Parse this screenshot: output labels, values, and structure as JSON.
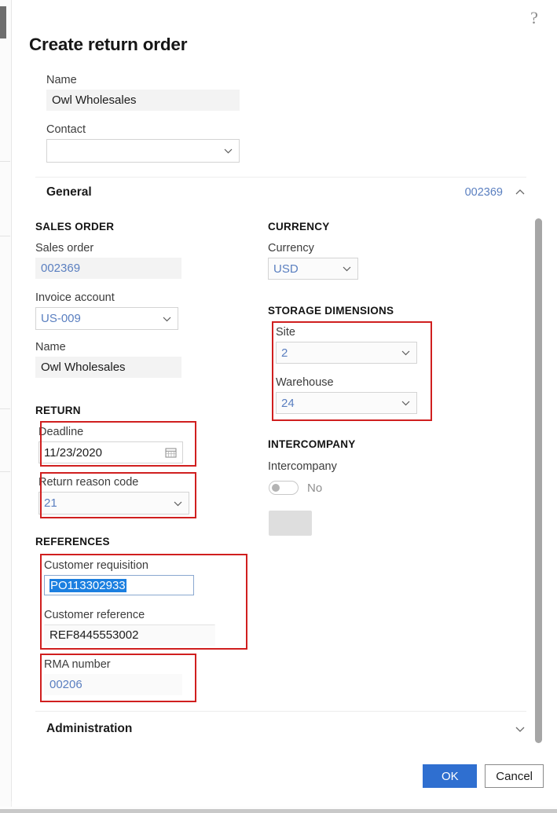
{
  "dialog": {
    "title": "Create return order",
    "help_icon": "question-mark-icon"
  },
  "top_fields": {
    "name": {
      "label": "Name",
      "value": "Owl Wholesales"
    },
    "contact": {
      "label": "Contact",
      "value": ""
    }
  },
  "sections": {
    "general": {
      "title": "General",
      "badge": "002369",
      "caret": "chevron-up-icon"
    },
    "administration": {
      "title": "Administration",
      "caret": "chevron-down-icon"
    }
  },
  "groups": {
    "sales_order": "SALES ORDER",
    "return": "RETURN",
    "references": "REFERENCES",
    "currency": "CURRENCY",
    "storage_dimensions": "STORAGE DIMENSIONS",
    "intercompany": "INTERCOMPANY"
  },
  "fields": {
    "sales_order": {
      "label": "Sales order",
      "value": "002369"
    },
    "invoice_account": {
      "label": "Invoice account",
      "value": "US-009"
    },
    "customer_name": {
      "label": "Name",
      "value": "Owl Wholesales"
    },
    "deadline": {
      "label": "Deadline",
      "value": "11/23/2020",
      "icon": "calendar-icon"
    },
    "return_reason_code": {
      "label": "Return reason code",
      "value": "21"
    },
    "customer_requisition": {
      "label": "Customer requisition",
      "value": "PO113302933"
    },
    "customer_reference": {
      "label": "Customer reference",
      "value": "REF8445553002"
    },
    "rma_number": {
      "label": "RMA number",
      "value": "00206"
    },
    "currency": {
      "label": "Currency",
      "value": "USD"
    },
    "site": {
      "label": "Site",
      "value": "2"
    },
    "warehouse": {
      "label": "Warehouse",
      "value": "24"
    },
    "intercompany_toggle": {
      "label": "Intercompany",
      "value": "No"
    }
  },
  "footer": {
    "ok": "OK",
    "cancel": "Cancel"
  },
  "colors": {
    "accent": "#2f6fd0",
    "link": "#5a7fc0",
    "annotation": "#d01f1f",
    "selection": "#1b7fe0"
  }
}
